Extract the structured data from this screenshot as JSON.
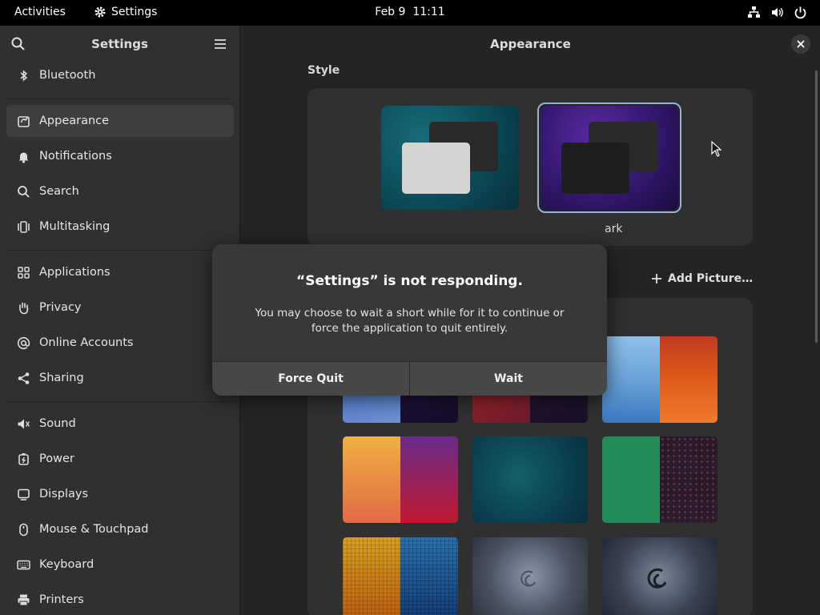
{
  "topbar": {
    "activities": "Activities",
    "app_name": "Settings",
    "date": "Feb 9",
    "time": "11:11"
  },
  "sidebar": {
    "title": "Settings",
    "items": [
      {
        "label": "Bluetooth",
        "icon": "bluetooth-icon"
      },
      {
        "label": "Appearance",
        "icon": "appearance-icon",
        "active": true
      },
      {
        "label": "Notifications",
        "icon": "bell-icon"
      },
      {
        "label": "Search",
        "icon": "search-icon"
      },
      {
        "label": "Multitasking",
        "icon": "multitasking-icon"
      },
      {
        "label": "Applications",
        "icon": "apps-grid-icon"
      },
      {
        "label": "Privacy",
        "icon": "hand-icon"
      },
      {
        "label": "Online Accounts",
        "icon": "at-icon"
      },
      {
        "label": "Sharing",
        "icon": "share-icon"
      },
      {
        "label": "Sound",
        "icon": "speaker-icon"
      },
      {
        "label": "Power",
        "icon": "power-icon"
      },
      {
        "label": "Displays",
        "icon": "display-icon"
      },
      {
        "label": "Mouse & Touchpad",
        "icon": "mouse-icon"
      },
      {
        "label": "Keyboard",
        "icon": "keyboard-icon"
      },
      {
        "label": "Printers",
        "icon": "printer-icon"
      }
    ]
  },
  "content": {
    "title": "Appearance",
    "style_heading": "Style",
    "dark_label_visible": "ark",
    "add_picture": "Add Picture…"
  },
  "dialog": {
    "title": "“Settings” is not responding.",
    "body": "You may choose to wait a short while for it to continue or force the application to quit entirely.",
    "force_quit": "Force Quit",
    "wait": "Wait"
  },
  "colors": {
    "accent_border": "#9db0d6",
    "window_bg": "#242424",
    "sidebar_bg": "#303030",
    "dialog_bg": "#383838"
  }
}
